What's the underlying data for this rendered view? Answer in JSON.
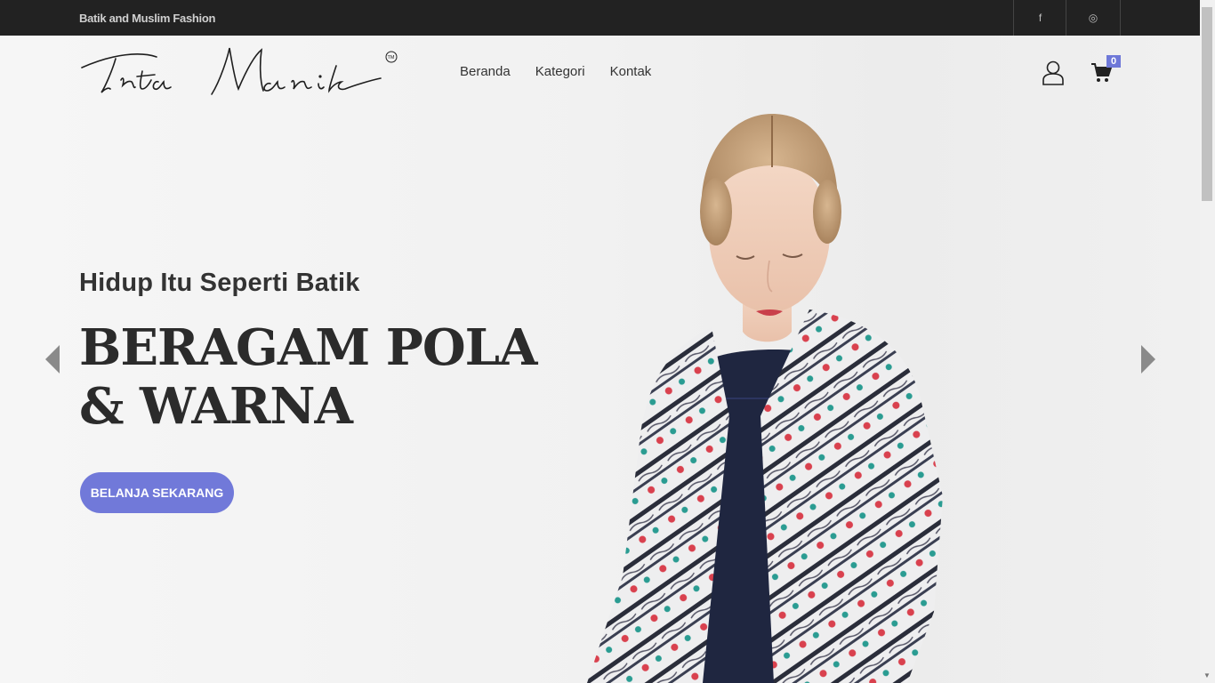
{
  "topbar": {
    "tagline": "Batik and Muslim Fashion",
    "facebook": "f",
    "instagram": "◎"
  },
  "brand": {
    "logo_text": "Tirta Manik",
    "trademark": "TM"
  },
  "nav": {
    "items": [
      {
        "label": "Beranda"
      },
      {
        "label": "Kategori"
      },
      {
        "label": "Kontak"
      }
    ]
  },
  "cart": {
    "count": "0"
  },
  "hero": {
    "subtitle": "Hidup Itu Seperti Batik",
    "headline_line1": "BERAGAM POLA",
    "headline_line2": "& WARNA",
    "cta_label": "BELANJA SEKARANG"
  },
  "colors": {
    "accent": "#7179d9",
    "topbar": "#222222",
    "text": "#2b2b2b"
  }
}
